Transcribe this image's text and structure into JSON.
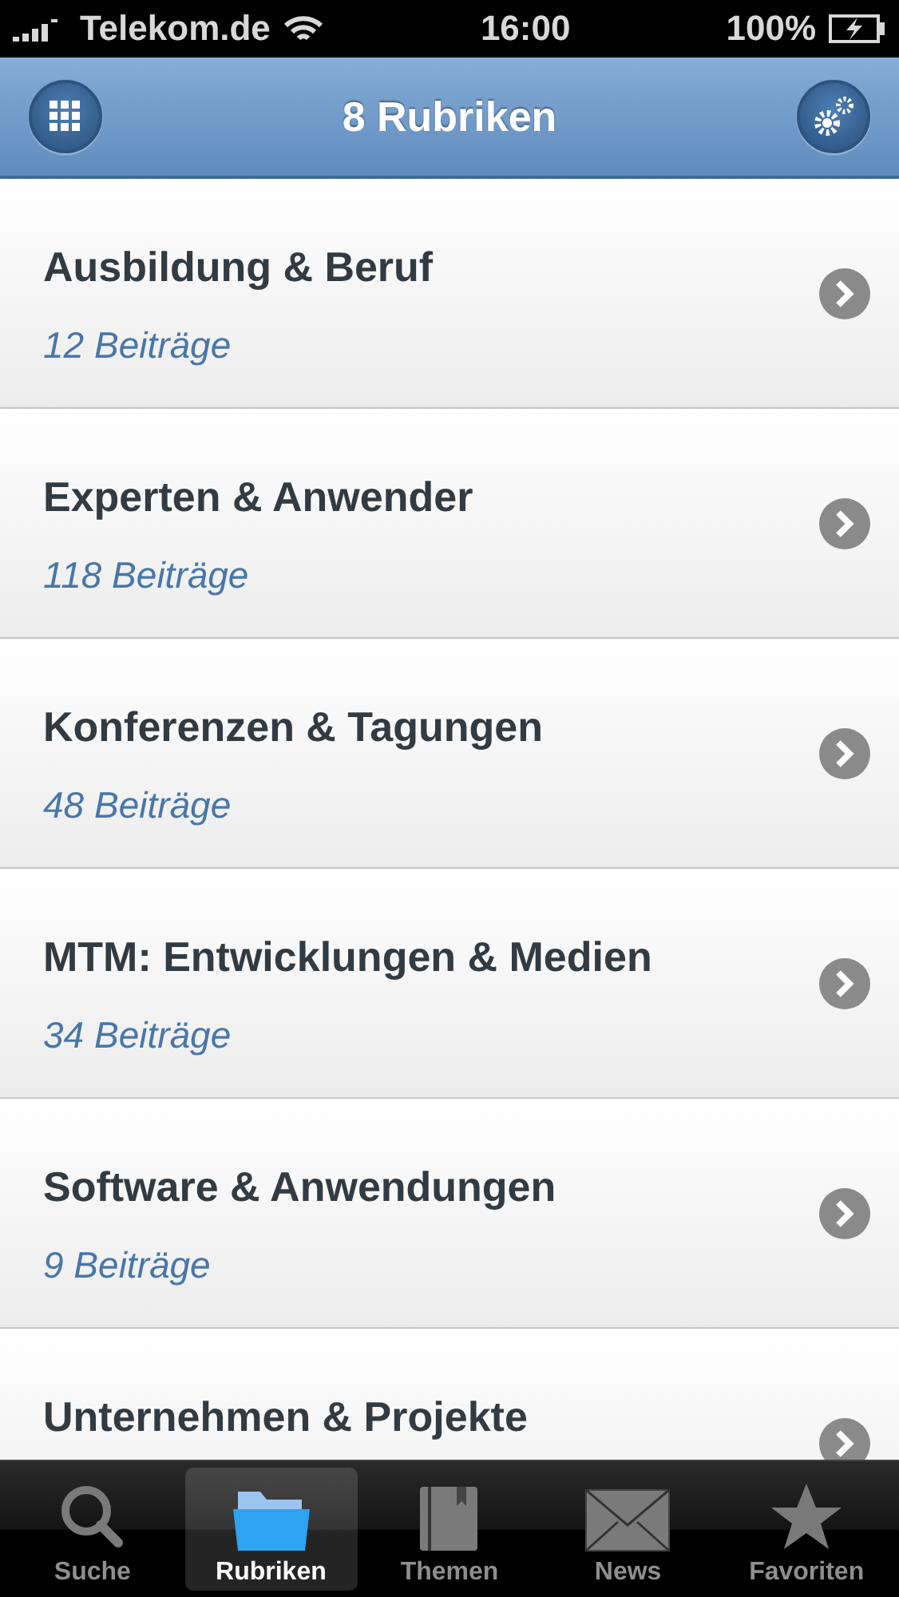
{
  "status_bar": {
    "carrier": "Telekom.de",
    "time": "16:00",
    "battery": "100%"
  },
  "nav_bar": {
    "title": "8 Rubriken"
  },
  "categories": [
    {
      "title": "Ausbildung & Beruf",
      "count": "12 Beiträge"
    },
    {
      "title": "Experten & Anwender",
      "count": "118 Beiträge"
    },
    {
      "title": "Konferenzen & Tagungen",
      "count": "48 Beiträge"
    },
    {
      "title": "MTM: Entwicklungen & Medien",
      "count": "34 Beiträge"
    },
    {
      "title": "Software & Anwendungen",
      "count": "9 Beiträge"
    },
    {
      "title": "Unternehmen & Projekte"
    }
  ],
  "tab_bar": [
    {
      "kind": "search",
      "label": "Suche",
      "selected": false
    },
    {
      "kind": "folder",
      "label": "Rubriken",
      "selected": true
    },
    {
      "kind": "book",
      "label": "Themen",
      "selected": false
    },
    {
      "kind": "mail",
      "label": "News",
      "selected": false
    },
    {
      "kind": "star",
      "label": "Favoriten",
      "selected": false
    }
  ]
}
